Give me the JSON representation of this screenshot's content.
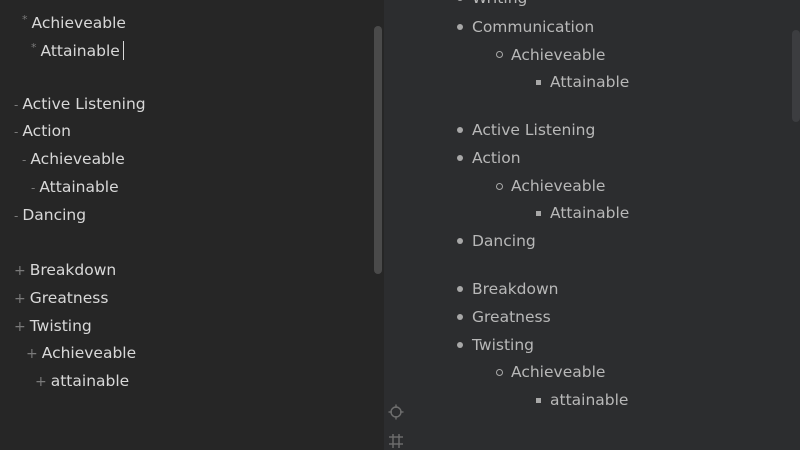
{
  "editor": {
    "lines": [
      {
        "marker": "*",
        "text": "Achieveable"
      },
      {
        "marker": "*",
        "text": "Attainable"
      },
      {
        "marker": "-",
        "text": "Active Listening"
      },
      {
        "marker": "-",
        "text": "Action"
      },
      {
        "marker": "-",
        "text": "Achieveable"
      },
      {
        "marker": "-",
        "text": "Attainable"
      },
      {
        "marker": "-",
        "text": "Dancing"
      },
      {
        "marker": "+",
        "text": "Breakdown"
      },
      {
        "marker": "+",
        "text": "Greatness"
      },
      {
        "marker": "+",
        "text": "Twisting"
      },
      {
        "marker": "+",
        "text": "Achieveable"
      },
      {
        "marker": "+",
        "text": "attainable"
      }
    ]
  },
  "preview": {
    "items": [
      {
        "text": "Writing"
      },
      {
        "text": "Communication"
      },
      {
        "text": "Achieveable"
      },
      {
        "text": "Attainable"
      },
      {
        "text": "Active Listening"
      },
      {
        "text": "Action"
      },
      {
        "text": "Achieveable"
      },
      {
        "text": "Attainable"
      },
      {
        "text": "Dancing"
      },
      {
        "text": "Breakdown"
      },
      {
        "text": "Greatness"
      },
      {
        "text": "Twisting"
      },
      {
        "text": "Achieveable"
      },
      {
        "text": "attainable"
      }
    ]
  },
  "icons": {
    "sync_scroll": "crosshair-icon",
    "layout_toggle": "split-layout-icon"
  },
  "colors": {
    "editor_bg": "#262626",
    "preview_bg": "#2c2d2f",
    "text": "#d8d8d8",
    "marker": "#7a7a7a"
  }
}
